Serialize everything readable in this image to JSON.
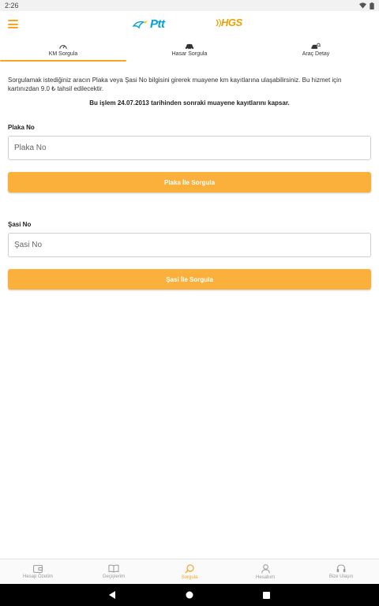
{
  "status_bar": {
    "time": "2:26"
  },
  "app_bar": {
    "ptt_logo_text": "Ptt",
    "hgs_logo_text": "HGS"
  },
  "tabs": [
    {
      "label": "KM Sorgula",
      "icon": "speedometer-icon",
      "active": true
    },
    {
      "label": "Hasar Sorgula",
      "icon": "car-crash-icon",
      "active": false
    },
    {
      "label": "Araç Detay",
      "icon": "car-search-icon",
      "active": false
    }
  ],
  "main": {
    "description": "Sorgulamak istediğiniz aracın Plaka veya Şasi No bilgisini girerek muayene km kayıtlarına ulaşabilirsiniz. Bu hizmet için kartınızdan 9.0 ₺ tahsil edilecektir.",
    "notice": "Bu işlem 24.07.2013 tarihinden sonraki muayene kayıtlarını kapsar.",
    "plaka": {
      "label": "Plaka No",
      "placeholder": "Plaka No",
      "value": "",
      "button": "Plaka İle Sorgula"
    },
    "sasi": {
      "label": "Şasi No",
      "placeholder": "Şasi No",
      "value": "",
      "button": "Şasi İle Sorgula"
    }
  },
  "bottom_nav": [
    {
      "label": "Hesap Özetim",
      "icon": "wallet-icon",
      "active": false
    },
    {
      "label": "Geçişlerim",
      "icon": "book-icon",
      "active": false
    },
    {
      "label": "Sorgula",
      "icon": "search-icon",
      "active": true
    },
    {
      "label": "Hesabım",
      "icon": "user-icon",
      "active": false
    },
    {
      "label": "Bize Ulaşın",
      "icon": "headset-icon",
      "active": false
    }
  ],
  "colors": {
    "accent": "#fbb03b",
    "ptt_blue": "#00a1de",
    "hgs_gold": "#e8a200"
  }
}
